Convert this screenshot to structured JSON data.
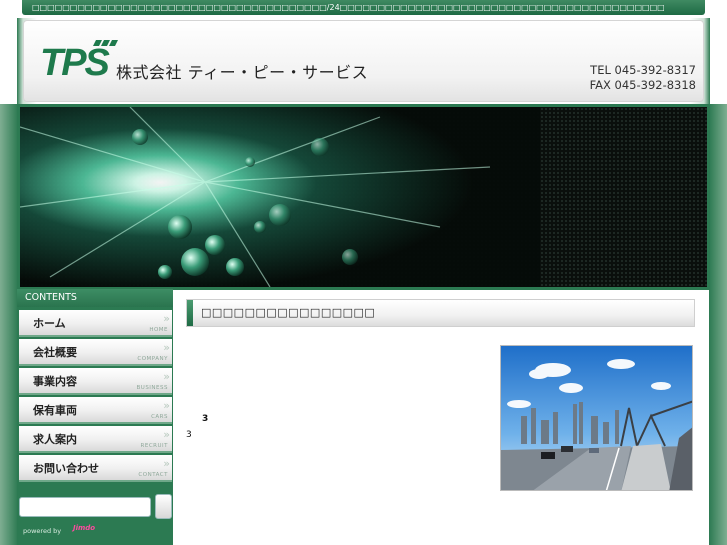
{
  "topbar": {
    "text": "□□□□□□□□□□□□□□□□□□□□□□□□□□□□□□□□□□□□□□□/24□□□□□□□□□□□□□□□□□□□□□□□□□□□□□□□□□□□□□□□□□□□"
  },
  "header": {
    "logo_text": "TPS",
    "company_name": "株式会社 ティー・ピー・サービス",
    "tel": "TEL 045-392-8317",
    "fax": "FAX 045-392-8318"
  },
  "sidebar": {
    "heading": "CONTENTS",
    "items": [
      {
        "label": "ホーム",
        "sub": "HOME"
      },
      {
        "label": "会社概要",
        "sub": "COMPANY"
      },
      {
        "label": "事業内容",
        "sub": "BUSINESS"
      },
      {
        "label": "保有車両",
        "sub": "CARS"
      },
      {
        "label": "求人案内",
        "sub": "RECRUIT"
      },
      {
        "label": "お問い合わせ",
        "sub": "CONTACT"
      }
    ],
    "powered_by": "powered by",
    "powered_logo": "Jimdo"
  },
  "main": {
    "section_title": "□□□□□□□□□□□□□□□□",
    "text_a": "3",
    "text_b": "3"
  },
  "colors": {
    "brand_green": "#2c7a52",
    "accent_pink": "#ff4aa0"
  }
}
